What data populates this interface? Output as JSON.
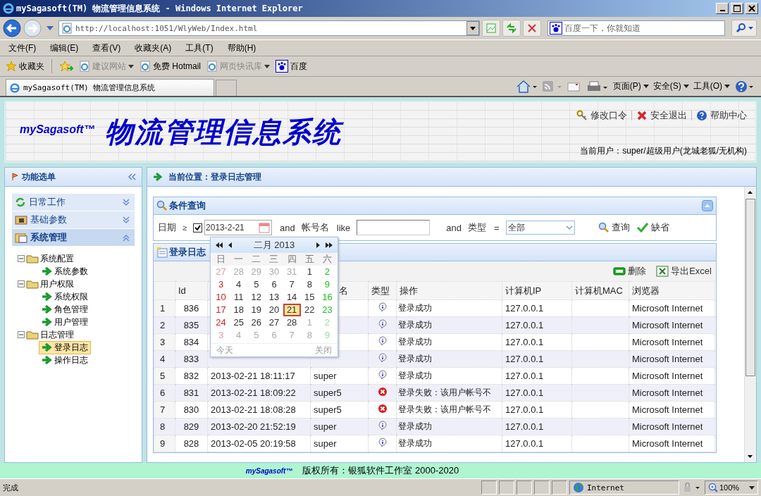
{
  "window": {
    "title": "mySagasoft(TM) 物流管理信息系统 - Windows Internet Explorer"
  },
  "address_bar": {
    "url": "http://localhost:1051/WlyWeb/Index.html",
    "search_placeholder": "百度一下，你就知道"
  },
  "menu": [
    "文件(F)",
    "编辑(E)",
    "查看(V)",
    "收藏夹(A)",
    "工具(T)",
    "帮助(H)"
  ],
  "favorites_bar": {
    "label": "收藏夹",
    "items": [
      {
        "label": "建议网站",
        "disabled": true,
        "dropdown": true
      },
      {
        "label": "免费 Hotmail",
        "disabled": false,
        "dropdown": false
      },
      {
        "label": "网页快讯库",
        "disabled": true,
        "dropdown": true
      },
      {
        "label": "百度",
        "disabled": false,
        "dropdown": false
      }
    ]
  },
  "browser_tab": {
    "title": "mySagasoft(TM) 物流管理信息系统"
  },
  "command_bar": [
    "页面(P)",
    "安全(S)",
    "工具(O)"
  ],
  "header": {
    "logo": "mySagasoft™",
    "title": "物流管理信息系统",
    "links": [
      "修改口令",
      "安全退出",
      "帮助中心"
    ],
    "user": "当前用户：super/超级用户(龙城老狐/无机构)"
  },
  "sidebar": {
    "title": "功能选单",
    "sections": [
      {
        "label": "日常工作",
        "expanded": false
      },
      {
        "label": "基础参数",
        "expanded": false
      },
      {
        "label": "系统管理",
        "expanded": true
      }
    ],
    "tree": [
      {
        "label": "系统配置",
        "expanded": true,
        "children": [
          {
            "label": "系统参数",
            "selected": false
          }
        ]
      },
      {
        "label": "用户权限",
        "expanded": true,
        "children": [
          {
            "label": "系统权限",
            "selected": false
          },
          {
            "label": "角色管理",
            "selected": false
          },
          {
            "label": "用户管理",
            "selected": false
          }
        ]
      },
      {
        "label": "日志管理",
        "expanded": true,
        "children": [
          {
            "label": "登录日志",
            "selected": true
          },
          {
            "label": "操作日志",
            "selected": false
          }
        ]
      }
    ]
  },
  "breadcrumb": "当前位置：登录日志管理",
  "query": {
    "title": "条件查询",
    "date_label": "日期",
    "date_op": "≥",
    "date_enabled": true,
    "date_value": "2013-2-21",
    "and_1": "and",
    "account_label": "帐号名",
    "account_op": "like",
    "and_2": "and",
    "type_label": "类型",
    "type_op": "=",
    "type_value": "全部",
    "search_button": "查询",
    "reset_button": "缺省"
  },
  "calendar": {
    "month": "二月 2013",
    "weekdays": [
      "日",
      "一",
      "二",
      "三",
      "四",
      "五",
      "六"
    ],
    "weeks": [
      [
        {
          "d": "27",
          "muted": true,
          "selected": false
        },
        {
          "d": "28",
          "muted": true,
          "selected": false
        },
        {
          "d": "29",
          "muted": true,
          "selected": false
        },
        {
          "d": "30",
          "muted": true,
          "selected": false
        },
        {
          "d": "31",
          "muted": true,
          "selected": false
        },
        {
          "d": "1",
          "muted": false,
          "selected": false
        },
        {
          "d": "2",
          "muted": false,
          "selected": false
        }
      ],
      [
        {
          "d": "3",
          "muted": false,
          "selected": false
        },
        {
          "d": "4",
          "muted": false,
          "selected": false
        },
        {
          "d": "5",
          "muted": false,
          "selected": false
        },
        {
          "d": "6",
          "muted": false,
          "selected": false
        },
        {
          "d": "7",
          "muted": false,
          "selected": false
        },
        {
          "d": "8",
          "muted": false,
          "selected": false
        },
        {
          "d": "9",
          "muted": false,
          "selected": false
        }
      ],
      [
        {
          "d": "10",
          "muted": false,
          "selected": false
        },
        {
          "d": "11",
          "muted": false,
          "selected": false
        },
        {
          "d": "12",
          "muted": false,
          "selected": false
        },
        {
          "d": "13",
          "muted": false,
          "selected": false
        },
        {
          "d": "14",
          "muted": false,
          "selected": false
        },
        {
          "d": "15",
          "muted": false,
          "selected": false
        },
        {
          "d": "16",
          "muted": false,
          "selected": false
        }
      ],
      [
        {
          "d": "17",
          "muted": false,
          "selected": false
        },
        {
          "d": "18",
          "muted": false,
          "selected": false
        },
        {
          "d": "19",
          "muted": false,
          "selected": false
        },
        {
          "d": "20",
          "muted": false,
          "selected": false
        },
        {
          "d": "21",
          "muted": false,
          "selected": true
        },
        {
          "d": "22",
          "muted": false,
          "selected": false
        },
        {
          "d": "23",
          "muted": false,
          "selected": false
        }
      ],
      [
        {
          "d": "24",
          "muted": false,
          "selected": false
        },
        {
          "d": "25",
          "muted": false,
          "selected": false
        },
        {
          "d": "26",
          "muted": false,
          "selected": false
        },
        {
          "d": "27",
          "muted": false,
          "selected": false
        },
        {
          "d": "28",
          "muted": false,
          "selected": false
        },
        {
          "d": "1",
          "muted": true,
          "selected": false
        },
        {
          "d": "2",
          "muted": true,
          "selected": false
        }
      ],
      [
        {
          "d": "3",
          "muted": true,
          "selected": false
        },
        {
          "d": "4",
          "muted": true,
          "selected": false
        },
        {
          "d": "5",
          "muted": true,
          "selected": false
        },
        {
          "d": "6",
          "muted": true,
          "selected": false
        },
        {
          "d": "7",
          "muted": true,
          "selected": false
        },
        {
          "d": "8",
          "muted": true,
          "selected": false
        },
        {
          "d": "9",
          "muted": true,
          "selected": false
        }
      ]
    ],
    "today": "今天",
    "close": "关闭"
  },
  "grid": {
    "title": "登录日志",
    "delete_button": "删除",
    "export_button": "导出Excel",
    "columns": [
      {},
      {
        "label": "Id"
      },
      {},
      {
        "label": "名"
      },
      {
        "label": "类型"
      },
      {
        "label": "操作"
      },
      {
        "label": "计算机IP"
      },
      {
        "label": "计算机MAC"
      },
      {
        "label": "浏览器"
      }
    ],
    "rows": [
      {
        "n": "1",
        "id": "836",
        "kind": "info",
        "op": "登录成功",
        "ip": "127.0.0.1",
        "browser": "Microsoft Internet"
      },
      {
        "n": "2",
        "id": "835",
        "kind": "info",
        "op": "登录成功",
        "ip": "127.0.0.1",
        "browser": "Microsoft Internet"
      },
      {
        "n": "3",
        "id": "834",
        "kind": "info",
        "op": "登录成功",
        "ip": "127.0.0.1",
        "browser": "Microsoft Internet"
      },
      {
        "n": "4",
        "id": "833",
        "kind": "info",
        "op": "登录成功",
        "ip": "127.0.0.1",
        "browser": "Microsoft Internet"
      },
      {
        "n": "5",
        "id": "832",
        "time": "2013-02-21 18:11:17",
        "user": "super",
        "kind": "info",
        "op": "登录成功",
        "ip": "127.0.0.1",
        "browser": "Microsoft Internet"
      },
      {
        "n": "6",
        "id": "831",
        "time": "2013-02-21 18:09:22",
        "user": "super5",
        "kind": "error",
        "op": "登录失败：该用户帐号不",
        "ip": "127.0.0.1",
        "browser": "Microsoft Internet"
      },
      {
        "n": "7",
        "id": "830",
        "time": "2013-02-21 18:08:28",
        "user": "super5",
        "kind": "error",
        "op": "登录失败：该用户帐号不",
        "ip": "127.0.0.1",
        "browser": "Microsoft Internet"
      },
      {
        "n": "8",
        "id": "829",
        "time": "2013-02-20 21:52:19",
        "user": "super",
        "kind": "info",
        "op": "登录成功",
        "ip": "127.0.0.1",
        "browser": "Microsoft Internet"
      },
      {
        "n": "9",
        "id": "828",
        "time": "2013-02-05 20:19:58",
        "user": "super",
        "kind": "info",
        "op": "登录成功",
        "ip": "127.0.0.1",
        "browser": "Microsoft Internet"
      }
    ]
  },
  "footer": {
    "logo": "mySagasoft™",
    "copyright": "版权所有：银狐软件工作室 2000-2020"
  },
  "status_bar": {
    "text": "完成",
    "zone": "Internet",
    "zoom": "100%"
  }
}
